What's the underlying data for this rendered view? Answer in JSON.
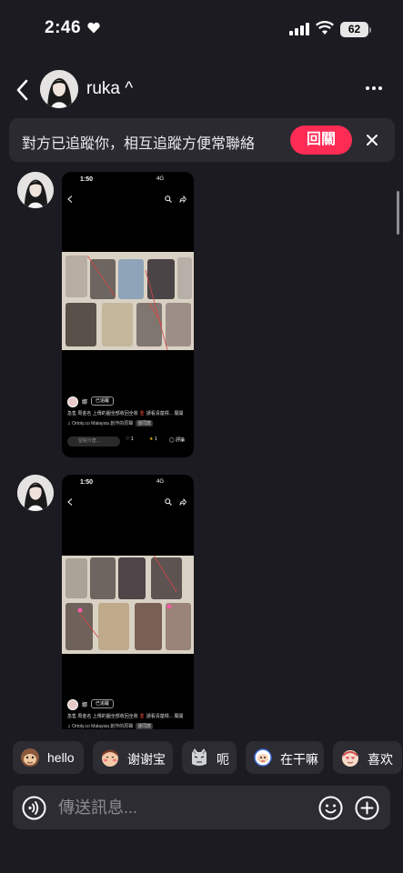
{
  "status_bar": {
    "time": "2:46",
    "battery": "62"
  },
  "header": {
    "name": "ruka ^"
  },
  "banner": {
    "text": "對方已追蹤你，相互追蹤方便常聯絡",
    "follow_back_label": "回關"
  },
  "messages": [
    {
      "card": {
        "time": "1:50",
        "network": "4G",
        "user": "娜",
        "badge": "已追蹤",
        "caption": "急售 周金名 上傳的圖全部收回全收 ‼️ 請看清楚標... 展開",
        "music": "♫ Ortoly.co Malaysia 創作的原聲",
        "music_badge": "發同款",
        "comment_placeholder": "留點什麼...",
        "likes": "1",
        "favorites": "1",
        "comments_label": "評論"
      }
    },
    {
      "card": {
        "time": "1:50",
        "network": "4G",
        "user": "娜",
        "badge": "已追蹤",
        "caption": "急售 周金名 上傳的圖全部收回全收 ‼️ 請看清楚標... 展開",
        "music": "♫ Ortoly.co Malaysia 創作的原聲",
        "music_badge": "發同款"
      }
    }
  ],
  "quick_replies": [
    {
      "label": "hello",
      "icon": "monkey-icon"
    },
    {
      "label": "谢谢宝",
      "icon": "blushing-face-icon"
    },
    {
      "label": "呃",
      "icon": "cat-face-icon"
    },
    {
      "label": "在干嘛",
      "icon": "peeking-face-icon"
    },
    {
      "label": "喜欢",
      "icon": "heart-eyes-icon"
    }
  ],
  "composer": {
    "placeholder": "傳送訊息..."
  },
  "colors": {
    "background": "#1c1b22",
    "accent": "#fe2c55",
    "surface": "#2d2c33"
  }
}
